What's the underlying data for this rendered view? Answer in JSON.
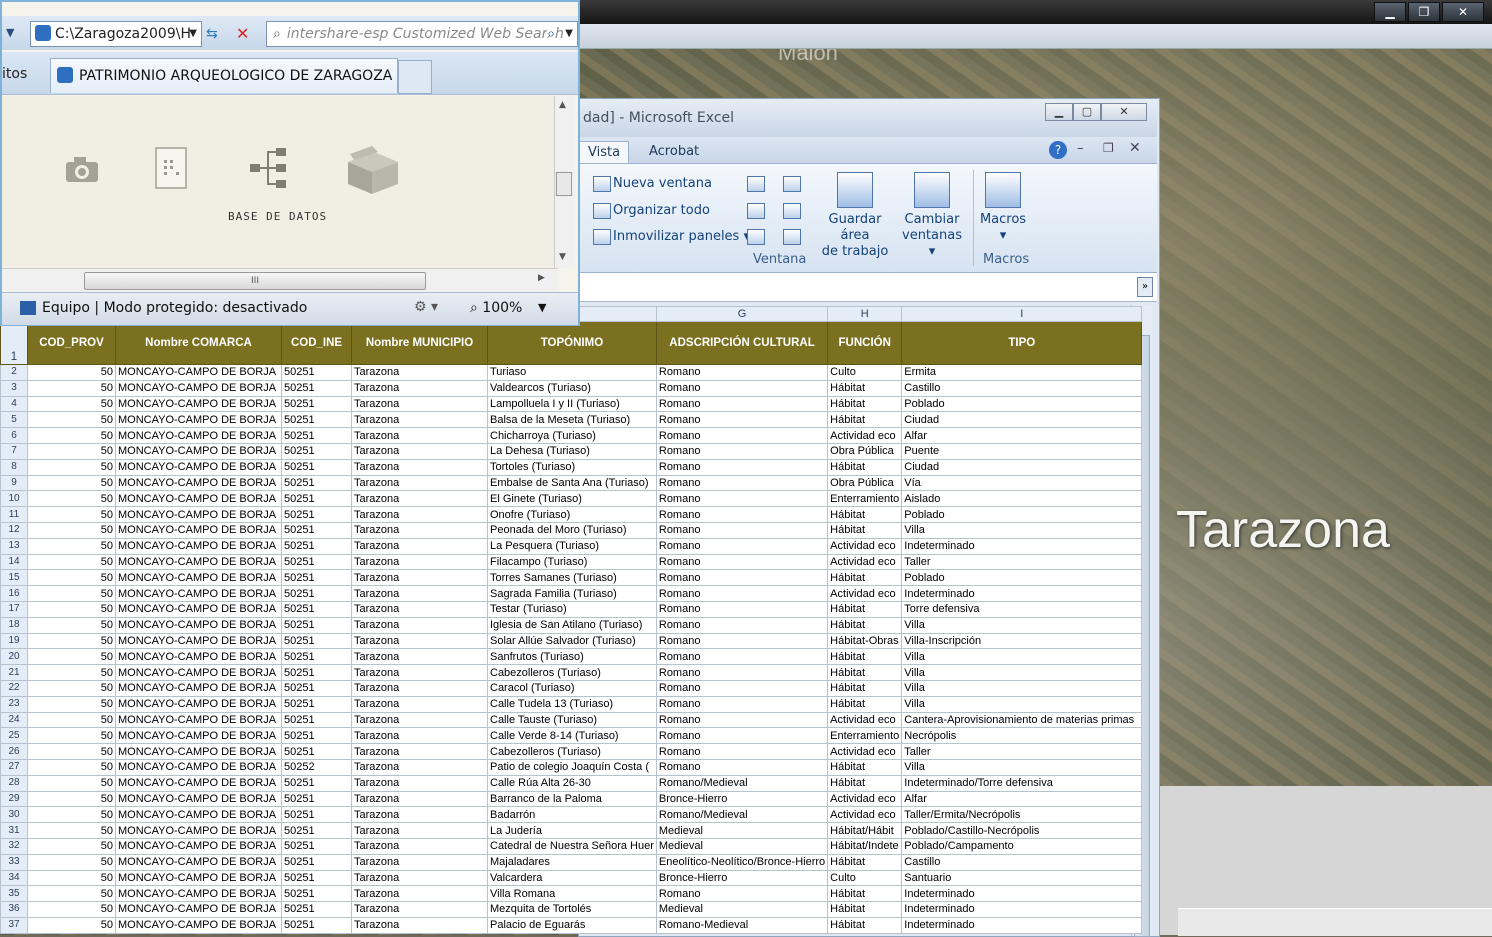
{
  "ie": {
    "address": "C:\\Zaragoza2009\\H",
    "search_placeholder": "intershare-esp Customized Web Search",
    "tabs_left_text": "itos",
    "tab_title": "PATRIMONIO ARQUEOLOGICO DE ZARAGOZA",
    "body_caption": "BASE DE DATOS",
    "scroll_grip": "III",
    "status_text": "Equipo | Modo protegido: desactivado",
    "zoom": "100%",
    "icons": [
      "camera-icon",
      "document-icon",
      "tree-icon",
      "box-icon"
    ]
  },
  "earth": {
    "label": "Tarazona",
    "top_label": "Malón"
  },
  "excel": {
    "title": "dad] - Microsoft Excel",
    "tabs": [
      "Vista",
      "Acrobat"
    ],
    "ribbon": {
      "nueva_ventana": "Nueva ventana",
      "organizar_todo": "Organizar todo",
      "inmovilizar": "Inmovilizar paneles",
      "guardar_area_1": "Guardar área",
      "guardar_area_2": "de trabajo",
      "cambiar_1": "Cambiar",
      "cambiar_2": "ventanas",
      "macros": "Macros",
      "group_ventana": "Ventana",
      "group_macros": "Macros"
    },
    "col_letters": [
      "",
      "",
      "",
      "",
      "",
      "",
      "G",
      "H",
      "I"
    ],
    "headers": [
      "COD_PROV",
      "Nombre COMARCA",
      "COD_INE",
      "Nombre MUNICIPIO",
      "TOPÓNIMO",
      "ADSCRIPCIÓN CULTURAL",
      "FUNCIÓN",
      "TIPO"
    ],
    "header_row_number": "1",
    "rows": [
      [
        "2",
        "50",
        "MONCAYO-CAMPO DE BORJA",
        "50251",
        "Tarazona",
        "Turiaso",
        "Romano",
        "Culto",
        "Ermita"
      ],
      [
        "3",
        "50",
        "MONCAYO-CAMPO DE BORJA",
        "50251",
        "Tarazona",
        "Valdearcos (Turiaso)",
        "Romano",
        "Hábitat",
        "Castillo"
      ],
      [
        "4",
        "50",
        "MONCAYO-CAMPO DE BORJA",
        "50251",
        "Tarazona",
        "Lampolluela I y II (Turiaso)",
        "Romano",
        "Hábitat",
        "Poblado"
      ],
      [
        "5",
        "50",
        "MONCAYO-CAMPO DE BORJA",
        "50251",
        "Tarazona",
        "Balsa de la Meseta (Turiaso)",
        "Romano",
        "Hábitat",
        "Ciudad"
      ],
      [
        "6",
        "50",
        "MONCAYO-CAMPO DE BORJA",
        "50251",
        "Tarazona",
        "Chicharroya (Turiaso)",
        "Romano",
        "Actividad eco",
        "Alfar"
      ],
      [
        "7",
        "50",
        "MONCAYO-CAMPO DE BORJA",
        "50251",
        "Tarazona",
        "La Dehesa (Turiaso)",
        "Romano",
        "Obra Pública",
        "Puente"
      ],
      [
        "8",
        "50",
        "MONCAYO-CAMPO DE BORJA",
        "50251",
        "Tarazona",
        "Tortoles (Turiaso)",
        "Romano",
        "Hábitat",
        "Ciudad"
      ],
      [
        "9",
        "50",
        "MONCAYO-CAMPO DE BORJA",
        "50251",
        "Tarazona",
        "Embalse de Santa Ana (Turiaso)",
        "Romano",
        "Obra Pública",
        "Vía"
      ],
      [
        "10",
        "50",
        "MONCAYO-CAMPO DE BORJA",
        "50251",
        "Tarazona",
        "El Ginete (Turiaso)",
        "Romano",
        "Enterramiento",
        "Aislado"
      ],
      [
        "11",
        "50",
        "MONCAYO-CAMPO DE BORJA",
        "50251",
        "Tarazona",
        "Onofre (Turiaso)",
        "Romano",
        "Hábitat",
        "Poblado"
      ],
      [
        "12",
        "50",
        "MONCAYO-CAMPO DE BORJA",
        "50251",
        "Tarazona",
        "Peonada del Moro (Turiaso)",
        "Romano",
        "Hábitat",
        "Villa"
      ],
      [
        "13",
        "50",
        "MONCAYO-CAMPO DE BORJA",
        "50251",
        "Tarazona",
        "La Pesquera (Turiaso)",
        "Romano",
        "Actividad eco",
        "Indeterminado"
      ],
      [
        "14",
        "50",
        "MONCAYO-CAMPO DE BORJA",
        "50251",
        "Tarazona",
        "Filacampo (Turiaso)",
        "Romano",
        "Actividad eco",
        "Taller"
      ],
      [
        "15",
        "50",
        "MONCAYO-CAMPO DE BORJA",
        "50251",
        "Tarazona",
        "Torres Samanes (Turiaso)",
        "Romano",
        "Hábitat",
        "Poblado"
      ],
      [
        "16",
        "50",
        "MONCAYO-CAMPO DE BORJA",
        "50251",
        "Tarazona",
        "Sagrada Familia (Turiaso)",
        "Romano",
        "Actividad eco",
        "Indeterminado"
      ],
      [
        "17",
        "50",
        "MONCAYO-CAMPO DE BORJA",
        "50251",
        "Tarazona",
        "Testar (Turiaso)",
        "Romano",
        "Hábitat",
        "Torre defensiva"
      ],
      [
        "18",
        "50",
        "MONCAYO-CAMPO DE BORJA",
        "50251",
        "Tarazona",
        "Iglesia de San Atilano (Turiaso)",
        "Romano",
        "Hábitat",
        "Villa"
      ],
      [
        "19",
        "50",
        "MONCAYO-CAMPO DE BORJA",
        "50251",
        "Tarazona",
        "Solar Allúe Salvador (Turiaso)",
        "Romano",
        "Hábitat-Obras",
        "Villa-Inscripción"
      ],
      [
        "20",
        "50",
        "MONCAYO-CAMPO DE BORJA",
        "50251",
        "Tarazona",
        "Sanfrutos (Turiaso)",
        "Romano",
        "Hábitat",
        "Villa"
      ],
      [
        "21",
        "50",
        "MONCAYO-CAMPO DE BORJA",
        "50251",
        "Tarazona",
        "Cabezolleros (Turiaso)",
        "Romano",
        "Hábitat",
        "Villa"
      ],
      [
        "22",
        "50",
        "MONCAYO-CAMPO DE BORJA",
        "50251",
        "Tarazona",
        "Caracol (Turiaso)",
        "Romano",
        "Hábitat",
        "Villa"
      ],
      [
        "23",
        "50",
        "MONCAYO-CAMPO DE BORJA",
        "50251",
        "Tarazona",
        "Calle Tudela 13 (Turiaso)",
        "Romano",
        "Hábitat",
        "Villa"
      ],
      [
        "24",
        "50",
        "MONCAYO-CAMPO DE BORJA",
        "50251",
        "Tarazona",
        "Calle Tauste (Turiaso)",
        "Romano",
        "Actividad eco",
        "Cantera-Aprovisionamiento de materias primas"
      ],
      [
        "25",
        "50",
        "MONCAYO-CAMPO DE BORJA",
        "50251",
        "Tarazona",
        "Calle Verde 8-14 (Turiaso)",
        "Romano",
        "Enterramiento",
        "Necrópolis"
      ],
      [
        "26",
        "50",
        "MONCAYO-CAMPO DE BORJA",
        "50251",
        "Tarazona",
        "Cabezolleros (Turiaso)",
        "Romano",
        "Actividad eco",
        "Taller"
      ],
      [
        "27",
        "50",
        "MONCAYO-CAMPO DE BORJA",
        "50252",
        "Tarazona",
        "Patio de colegio Joaquín Costa (",
        "Romano",
        "Hábitat",
        "Villa"
      ],
      [
        "28",
        "50",
        "MONCAYO-CAMPO DE BORJA",
        "50251",
        "Tarazona",
        "Calle Rúa Alta 26-30",
        "Romano/Medieval",
        "Hábitat",
        "Indeterminado/Torre defensiva"
      ],
      [
        "29",
        "50",
        "MONCAYO-CAMPO DE BORJA",
        "50251",
        "Tarazona",
        "Barranco de la Paloma",
        "Bronce-Hierro",
        "Actividad eco",
        "Alfar"
      ],
      [
        "30",
        "50",
        "MONCAYO-CAMPO DE BORJA",
        "50251",
        "Tarazona",
        "Badarrón",
        "Romano/Medieval",
        "Actividad eco",
        "Taller/Ermita/Necrópolis"
      ],
      [
        "31",
        "50",
        "MONCAYO-CAMPO DE BORJA",
        "50251",
        "Tarazona",
        "La Judería",
        "Medieval",
        "Hábitat/Hábit",
        "Poblado/Castillo-Necrópolis"
      ],
      [
        "32",
        "50",
        "MONCAYO-CAMPO DE BORJA",
        "50251",
        "Tarazona",
        "Catedral de Nuestra Señora Huer",
        "Medieval",
        "Hábitat/Indete",
        "Poblado/Campamento"
      ],
      [
        "33",
        "50",
        "MONCAYO-CAMPO DE BORJA",
        "50251",
        "Tarazona",
        "Majaladares",
        "Eneolítico-Neolítico/Bronce-Hierro",
        "Hábitat",
        "Castillo"
      ],
      [
        "34",
        "50",
        "MONCAYO-CAMPO DE BORJA",
        "50251",
        "Tarazona",
        "Valcardera",
        "Bronce-Hierro",
        "Culto",
        "Santuario"
      ],
      [
        "35",
        "50",
        "MONCAYO-CAMPO DE BORJA",
        "50251",
        "Tarazona",
        "Villa Romana",
        "Romano",
        "Hábitat",
        "Indeterminado"
      ],
      [
        "36",
        "50",
        "MONCAYO-CAMPO DE BORJA",
        "50251",
        "Tarazona",
        "Mezquita de Tortolés",
        "Medieval",
        "Hábitat",
        "Indeterminado"
      ],
      [
        "37",
        "50",
        "MONCAYO-CAMPO DE BORJA",
        "50251",
        "Tarazona",
        "Palacio de Eguarás",
        "Romano-Medieval",
        "Hábitat",
        "Indeterminado"
      ]
    ]
  }
}
